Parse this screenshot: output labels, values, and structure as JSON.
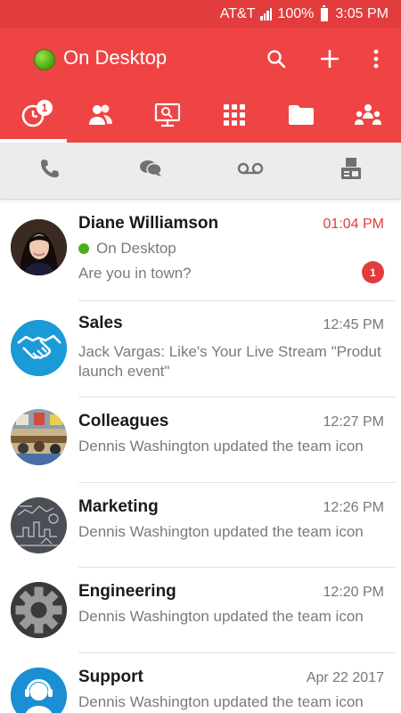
{
  "status_bar": {
    "carrier": "AT&T",
    "battery": "100%",
    "time": "3:05 PM"
  },
  "app_bar": {
    "presence_label": "On Desktop",
    "presence_color": "#4caf22",
    "brand_color": "#ee4444"
  },
  "tabs": [
    {
      "name": "recent-icon",
      "badge": "1",
      "active": true
    },
    {
      "name": "contacts-icon"
    },
    {
      "name": "meetings-icon"
    },
    {
      "name": "dialpad-icon"
    },
    {
      "name": "files-icon"
    },
    {
      "name": "teams-icon"
    }
  ],
  "subtabs": [
    "phone-icon",
    "chat-icon",
    "voicemail-icon",
    "fax-icon"
  ],
  "conversations": [
    {
      "title": "Diane Williamson",
      "time": "01:04 PM",
      "presence": "On Desktop",
      "preview": "Are you in town?",
      "unread": "1",
      "avatar": "photo-portrait"
    },
    {
      "title": "Sales",
      "time": "12:45 PM",
      "preview": "Jack Vargas: Like's Your Live Stream \"Produt launch event\"",
      "avatar": "handshake-icon"
    },
    {
      "title": "Colleagues",
      "time": "12:27 PM",
      "preview": "Dennis Washington updated the team icon",
      "avatar": "photo-office"
    },
    {
      "title": "Marketing",
      "time": "12:26 PM",
      "preview": "Dennis Washington updated the team icon",
      "avatar": "photo-chalkboard"
    },
    {
      "title": "Engineering",
      "time": "12:20 PM",
      "preview": "Dennis Washington updated the team icon",
      "avatar": "gear-icon"
    },
    {
      "title": "Support",
      "time": "Apr 22 2017",
      "preview": "Dennis Washington updated the team icon",
      "avatar": "headset-icon"
    }
  ]
}
